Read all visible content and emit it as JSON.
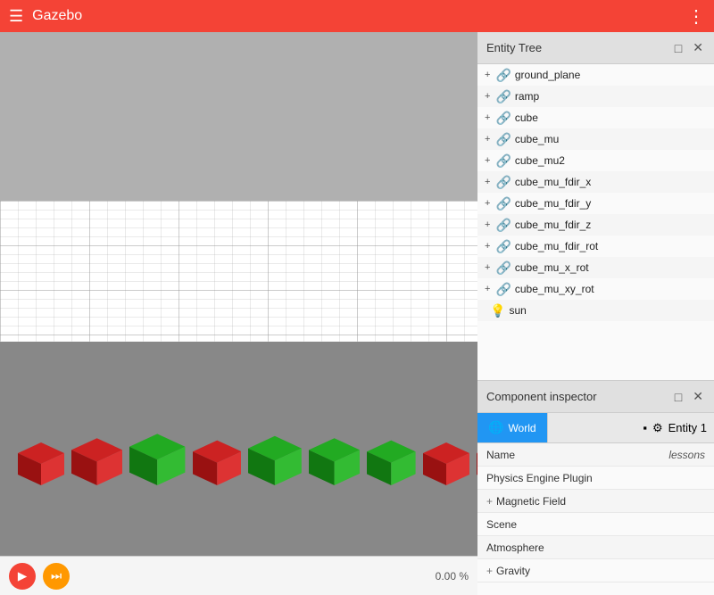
{
  "topbar": {
    "title": "Gazebo",
    "hamburger": "☰",
    "more": "⋮"
  },
  "viewport": {
    "zoom_label": "0.00 %"
  },
  "controls": {
    "play_label": "▶",
    "step_label": "⏭"
  },
  "entity_tree": {
    "title": "Entity Tree",
    "minimize": "□",
    "close": "✕",
    "entities": [
      {
        "id": "ground_plane",
        "label": "ground_plane",
        "expandable": true,
        "icon": "🔗"
      },
      {
        "id": "ramp",
        "label": "ramp",
        "expandable": true,
        "icon": "🔗"
      },
      {
        "id": "cube",
        "label": "cube",
        "expandable": true,
        "icon": "🔗"
      },
      {
        "id": "cube_mu",
        "label": "cube_mu",
        "expandable": true,
        "icon": "🔗"
      },
      {
        "id": "cube_mu2",
        "label": "cube_mu2",
        "expandable": true,
        "icon": "🔗"
      },
      {
        "id": "cube_mu_fdir_x",
        "label": "cube_mu_fdir_x",
        "expandable": true,
        "icon": "🔗"
      },
      {
        "id": "cube_mu_fdir_y",
        "label": "cube_mu_fdir_y",
        "expandable": true,
        "icon": "🔗"
      },
      {
        "id": "cube_mu_fdir_z",
        "label": "cube_mu_fdir_z",
        "expandable": true,
        "icon": "🔗"
      },
      {
        "id": "cube_mu_fdir_rot",
        "label": "cube_mu_fdir_rot",
        "expandable": true,
        "icon": "🔗"
      },
      {
        "id": "cube_mu_x_rot",
        "label": "cube_mu_x_rot",
        "expandable": true,
        "icon": "🔗"
      },
      {
        "id": "cube_mu_xy_rot",
        "label": "cube_mu_xy_rot",
        "expandable": true,
        "icon": "🔗"
      },
      {
        "id": "sun",
        "label": "sun",
        "expandable": false,
        "icon": "💡"
      }
    ]
  },
  "component_inspector": {
    "title": "Component inspector",
    "minimize": "□",
    "close": "✕",
    "world_tab": {
      "label": "World",
      "icon": "🌐"
    },
    "entity_tab": {
      "label": "Entity 1"
    },
    "pause_icon": "⏸",
    "settings_icon": "⚙",
    "rows": [
      {
        "label": "Name",
        "value": "lessons",
        "expandable": false
      },
      {
        "label": "Physics Engine Plugin",
        "value": "",
        "expandable": false
      },
      {
        "label": "Magnetic Field",
        "value": "",
        "expandable": true
      },
      {
        "label": "Scene",
        "value": "",
        "expandable": false
      },
      {
        "label": "Atmosphere",
        "value": "",
        "expandable": false
      },
      {
        "label": "Gravity",
        "value": "",
        "expandable": true
      }
    ]
  },
  "cubes": [
    {
      "color": "red",
      "size": 40
    },
    {
      "color": "red",
      "size": 44
    },
    {
      "color": "green",
      "size": 48
    },
    {
      "color": "red",
      "size": 42
    },
    {
      "color": "green",
      "size": 46
    },
    {
      "color": "green",
      "size": 44
    },
    {
      "color": "green",
      "size": 42
    },
    {
      "color": "red",
      "size": 40
    },
    {
      "color": "red",
      "size": 40
    }
  ]
}
